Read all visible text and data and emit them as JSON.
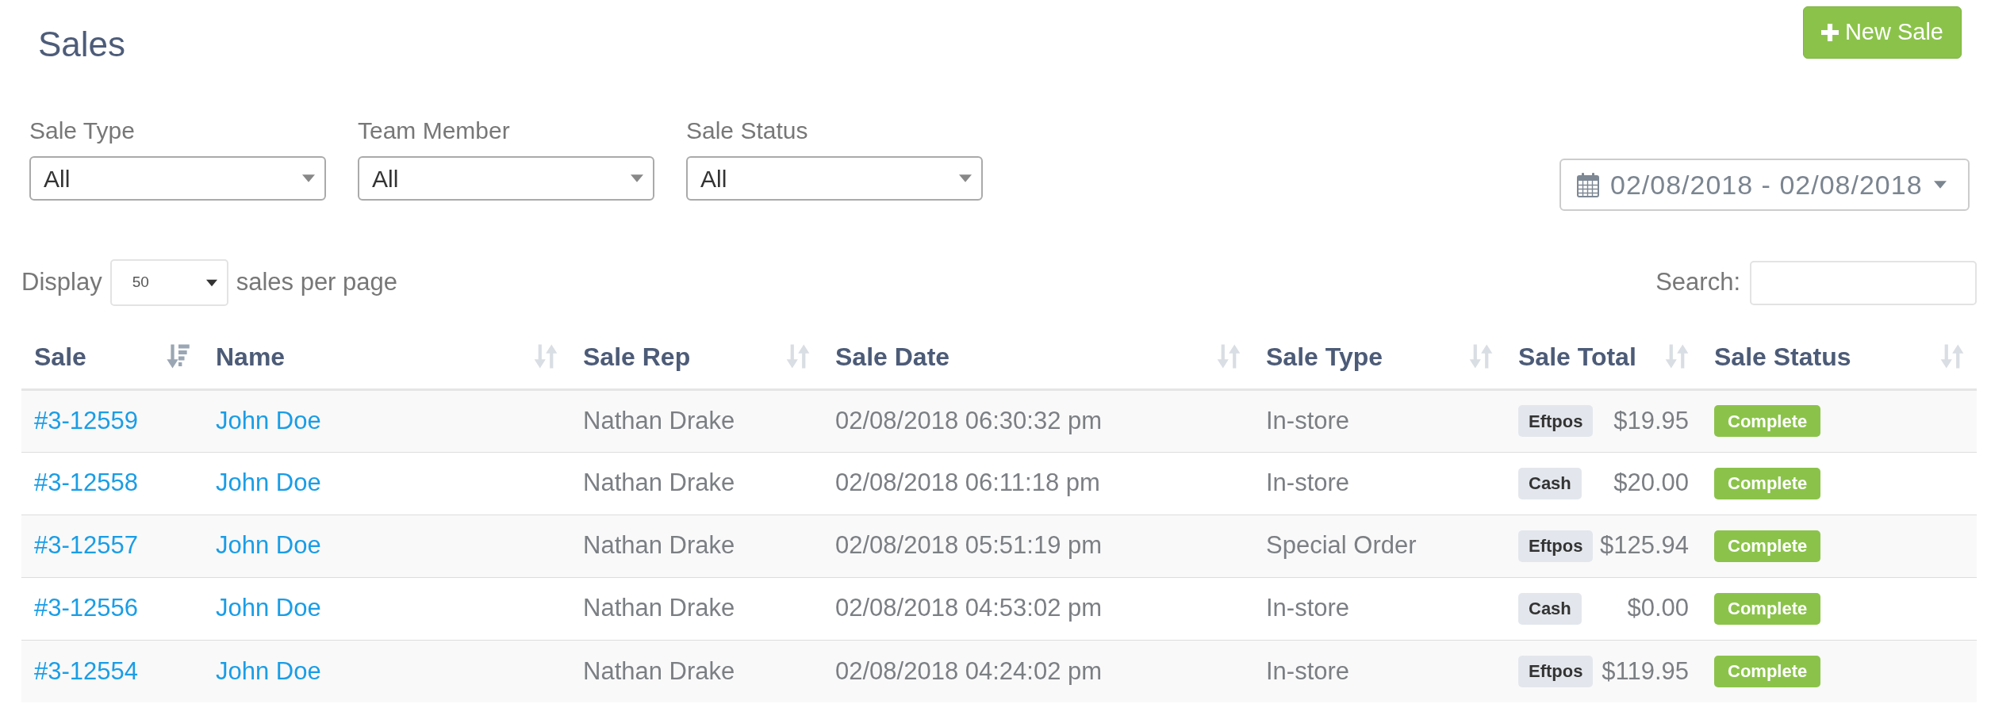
{
  "page": {
    "title": "Sales"
  },
  "new_sale_button": {
    "label": "New Sale"
  },
  "filters": [
    {
      "label": "Sale Type",
      "value": "All"
    },
    {
      "label": "Team Member",
      "value": "All"
    },
    {
      "label": "Sale Status",
      "value": "All"
    }
  ],
  "date_range": {
    "value": "02/08/2018 - 02/08/2018"
  },
  "page_size": {
    "prefix": "Display",
    "value": "50",
    "suffix": "sales per page"
  },
  "search": {
    "label": "Search:"
  },
  "table": {
    "columns": [
      {
        "label": "Sale",
        "sorted": true
      },
      {
        "label": "Name",
        "sorted": false
      },
      {
        "label": "Sale Rep",
        "sorted": false
      },
      {
        "label": "Sale Date",
        "sorted": false
      },
      {
        "label": "Sale Type",
        "sorted": false
      },
      {
        "label": "Sale Total",
        "sorted": false
      },
      {
        "label": "Sale Status",
        "sorted": false
      }
    ],
    "rows": [
      {
        "sale": "#3-12559",
        "name": "John Doe",
        "sale_rep": "Nathan Drake",
        "sale_date": "02/08/2018 06:30:32 pm",
        "sale_type": "In-store",
        "payment": "Eftpos",
        "total": "$19.95",
        "status": "Complete"
      },
      {
        "sale": "#3-12558",
        "name": "John Doe",
        "sale_rep": "Nathan Drake",
        "sale_date": "02/08/2018 06:11:18 pm",
        "sale_type": "In-store",
        "payment": "Cash",
        "total": "$20.00",
        "status": "Complete"
      },
      {
        "sale": "#3-12557",
        "name": "John Doe",
        "sale_rep": "Nathan Drake",
        "sale_date": "02/08/2018 05:51:19 pm",
        "sale_type": "Special Order",
        "payment": "Eftpos",
        "total": "$125.94",
        "status": "Complete"
      },
      {
        "sale": "#3-12556",
        "name": "John Doe",
        "sale_rep": "Nathan Drake",
        "sale_date": "02/08/2018 04:53:02 pm",
        "sale_type": "In-store",
        "payment": "Cash",
        "total": "$0.00",
        "status": "Complete"
      },
      {
        "sale": "#3-12554",
        "name": "John Doe",
        "sale_rep": "Nathan Drake",
        "sale_date": "02/08/2018 04:24:02 pm",
        "sale_type": "In-store",
        "payment": "Eftpos",
        "total": "$119.95",
        "status": "Complete"
      }
    ]
  }
}
